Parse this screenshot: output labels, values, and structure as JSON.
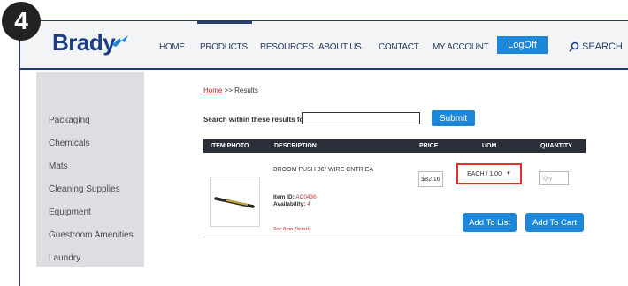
{
  "step_number": "4",
  "brand": {
    "logo_text": "Brady"
  },
  "nav": {
    "items": [
      "HOME",
      "PRODUCTS",
      "RESOURCES",
      "ABOUT US",
      "CONTACT",
      "MY ACCOUNT"
    ],
    "logoff_label": "LogOff",
    "search_label": "SEARCH",
    "active_item": "PRODUCTS"
  },
  "sidebar": {
    "items": [
      "Packaging",
      "Chemicals",
      "Mats",
      "Cleaning Supplies",
      "Equipment",
      "Guestroom Amenities",
      "Laundry"
    ]
  },
  "breadcrumb": {
    "home": "Home",
    "separator": ">>",
    "current": "Results"
  },
  "search": {
    "label": "Search within these results for:",
    "value": "",
    "submit_label": "Submit"
  },
  "table": {
    "headers": [
      "ITEM PHOTO",
      "DESCRIPTION",
      "PRICE",
      "UOM",
      "QUANTITY"
    ],
    "row": {
      "description": "BROOM PUSH 36\" WIRE CNTR EA",
      "item_id_label": "Item ID:",
      "item_id": "AC0436",
      "availability_label": "Availability:",
      "availability": "4",
      "details_link": "See Item Details",
      "price": "$82.16",
      "uom": "EACH / 1.00",
      "qty_placeholder": "Qty",
      "add_to_list_label": "Add To List",
      "add_to_cart_label": "Add To Cart"
    }
  },
  "colors": {
    "accent_blue": "#1e88d8",
    "brand_navy": "#1b3e82",
    "highlight_red": "#e8302a"
  },
  "icons": {
    "uom_dropdown": "triangle-down",
    "search": "magnifier"
  }
}
